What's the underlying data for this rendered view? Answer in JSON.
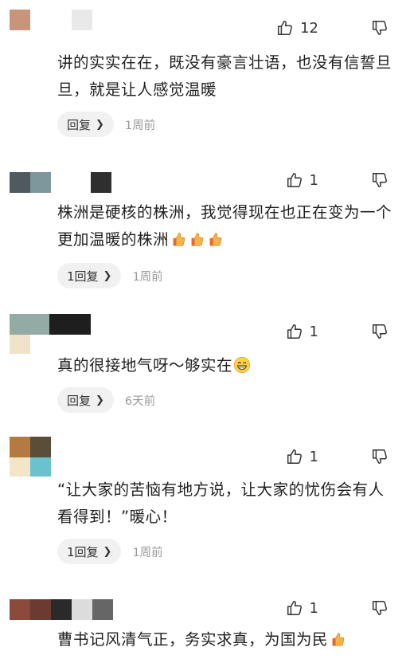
{
  "comments": [
    {
      "likes": "12",
      "text": "讲的实实在在，既没有豪言壮语，也没有信誓旦旦，就是让人感觉温暖",
      "reply_label": "回复",
      "time": "1周前",
      "avatar_colors": [
        "#c8957a",
        "#e9e9e9"
      ]
    },
    {
      "likes": "1",
      "text": "株洲是硬核的株洲，我觉得现在也正在变为一个更加温暖的株洲",
      "emojis": [
        "thumbs-up-emoji",
        "thumbs-up-emoji",
        "thumbs-up-emoji"
      ],
      "reply_label": "1回复",
      "time": "1周前",
      "avatar_colors": [
        "#4f5a5e",
        "#7d979c",
        "#2f2f2f"
      ]
    },
    {
      "likes": "1",
      "text": "真的很接地气呀～够实在",
      "emojis": [
        "grin-emoji"
      ],
      "reply_label": "回复",
      "time": "6天前",
      "avatar_colors": [
        "#93aaa5",
        "#1e1e1e",
        "#f1e3c9"
      ]
    },
    {
      "likes": "1",
      "text": "“让大家的苦恼有地方说，让大家的忧伤会有人看得到！”暖心！",
      "reply_label": "1回复",
      "time": "1周前",
      "avatar_colors": [
        "#b57a3f",
        "#5a4d3a",
        "#f2e5c8",
        "#6bc2cf"
      ]
    },
    {
      "likes": "1",
      "text": "曹书记风清气正，务实求真，为国为民",
      "emojis": [
        "thumbs-up-emoji"
      ],
      "avatar_colors": [
        "#8a4a3c",
        "#6b3b32",
        "#2a2a2a",
        "#dcdcdc",
        "#666666"
      ]
    }
  ],
  "icons": {
    "like": "thumb-up-outline-icon",
    "dislike": "thumb-down-outline-icon",
    "chevron": "chevron-right-icon"
  }
}
